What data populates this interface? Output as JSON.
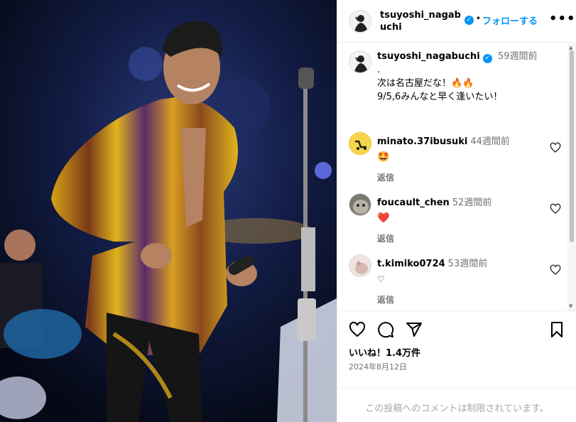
{
  "header": {
    "username": "tsuyoshi_nagabuchi",
    "follow_label": "フォローする",
    "dot": "•",
    "more_label": "•••"
  },
  "caption": {
    "username": "tsuyoshi_nagabuchi",
    "time": "59週間前",
    "lines": [
      ".",
      "次は名古屋だな！🔥🔥",
      "",
      "9/5,6みんなと早く逢いたい！"
    ]
  },
  "comments": [
    {
      "username": "minato.37ibusuki",
      "time": "44週間前",
      "text": "🤩",
      "reply_label": "返信"
    },
    {
      "username": "foucault_chen",
      "time": "52週間前",
      "text": "❤️",
      "reply_label": "返信"
    },
    {
      "username": "t.kimiko0724",
      "time": "53週間前",
      "text": "♡",
      "reply_label": "返信"
    }
  ],
  "actions": {
    "likes": "いいね！1.4万件",
    "date": "2024年8月12日"
  },
  "footer": {
    "limited_text": "この投稿へのコメントは制限されています。"
  },
  "icons": {
    "verified": "verified-badge-icon",
    "like": "heart-icon",
    "comment": "comment-icon",
    "share": "share-icon",
    "save": "bookmark-icon"
  },
  "colors": {
    "accent": "#0095f6",
    "muted": "#737373"
  }
}
